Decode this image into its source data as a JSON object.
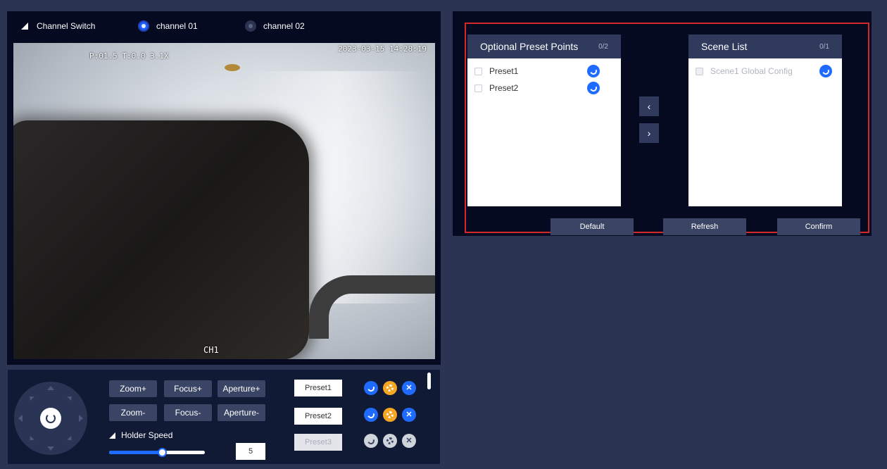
{
  "channel_switch": {
    "title": "Channel Switch",
    "channels": [
      {
        "label": "channel 01",
        "selected": true
      },
      {
        "label": "channel 02",
        "selected": false
      }
    ]
  },
  "video": {
    "osd_left": "P:01.5 T:0.0 3.1X",
    "osd_right": "2023-03-15 14:28:19",
    "osd_channel": "CH1"
  },
  "ptz": {
    "zoom_in": "Zoom+",
    "zoom_out": "Zoom-",
    "focus_in": "Focus+",
    "focus_out": "Focus-",
    "aperture_in": "Aperture+",
    "aperture_out": "Aperture-",
    "holder_speed_label": "Holder Speed",
    "holder_speed_value": "5",
    "holder_speed_fraction": 0.55,
    "presets": [
      {
        "label": "Preset1",
        "enabled": true
      },
      {
        "label": "Preset2",
        "enabled": true
      },
      {
        "label": "Preset3",
        "enabled": false
      }
    ]
  },
  "scene": {
    "optional_title": "Optional Preset Points",
    "optional_count": "0/2",
    "optional_items": [
      "Preset1",
      "Preset2"
    ],
    "scene_title": "Scene List",
    "scene_count": "0/1",
    "scene_items": [
      "Scene1 Global Config"
    ],
    "move_left": "‹",
    "move_right": "›",
    "default_label": "Default",
    "refresh_label": "Refresh",
    "confirm_label": "Confirm"
  },
  "colors": {
    "accent": "#1f6bff",
    "highlight_frame": "#d62828",
    "panel_bg": "#050a20"
  }
}
